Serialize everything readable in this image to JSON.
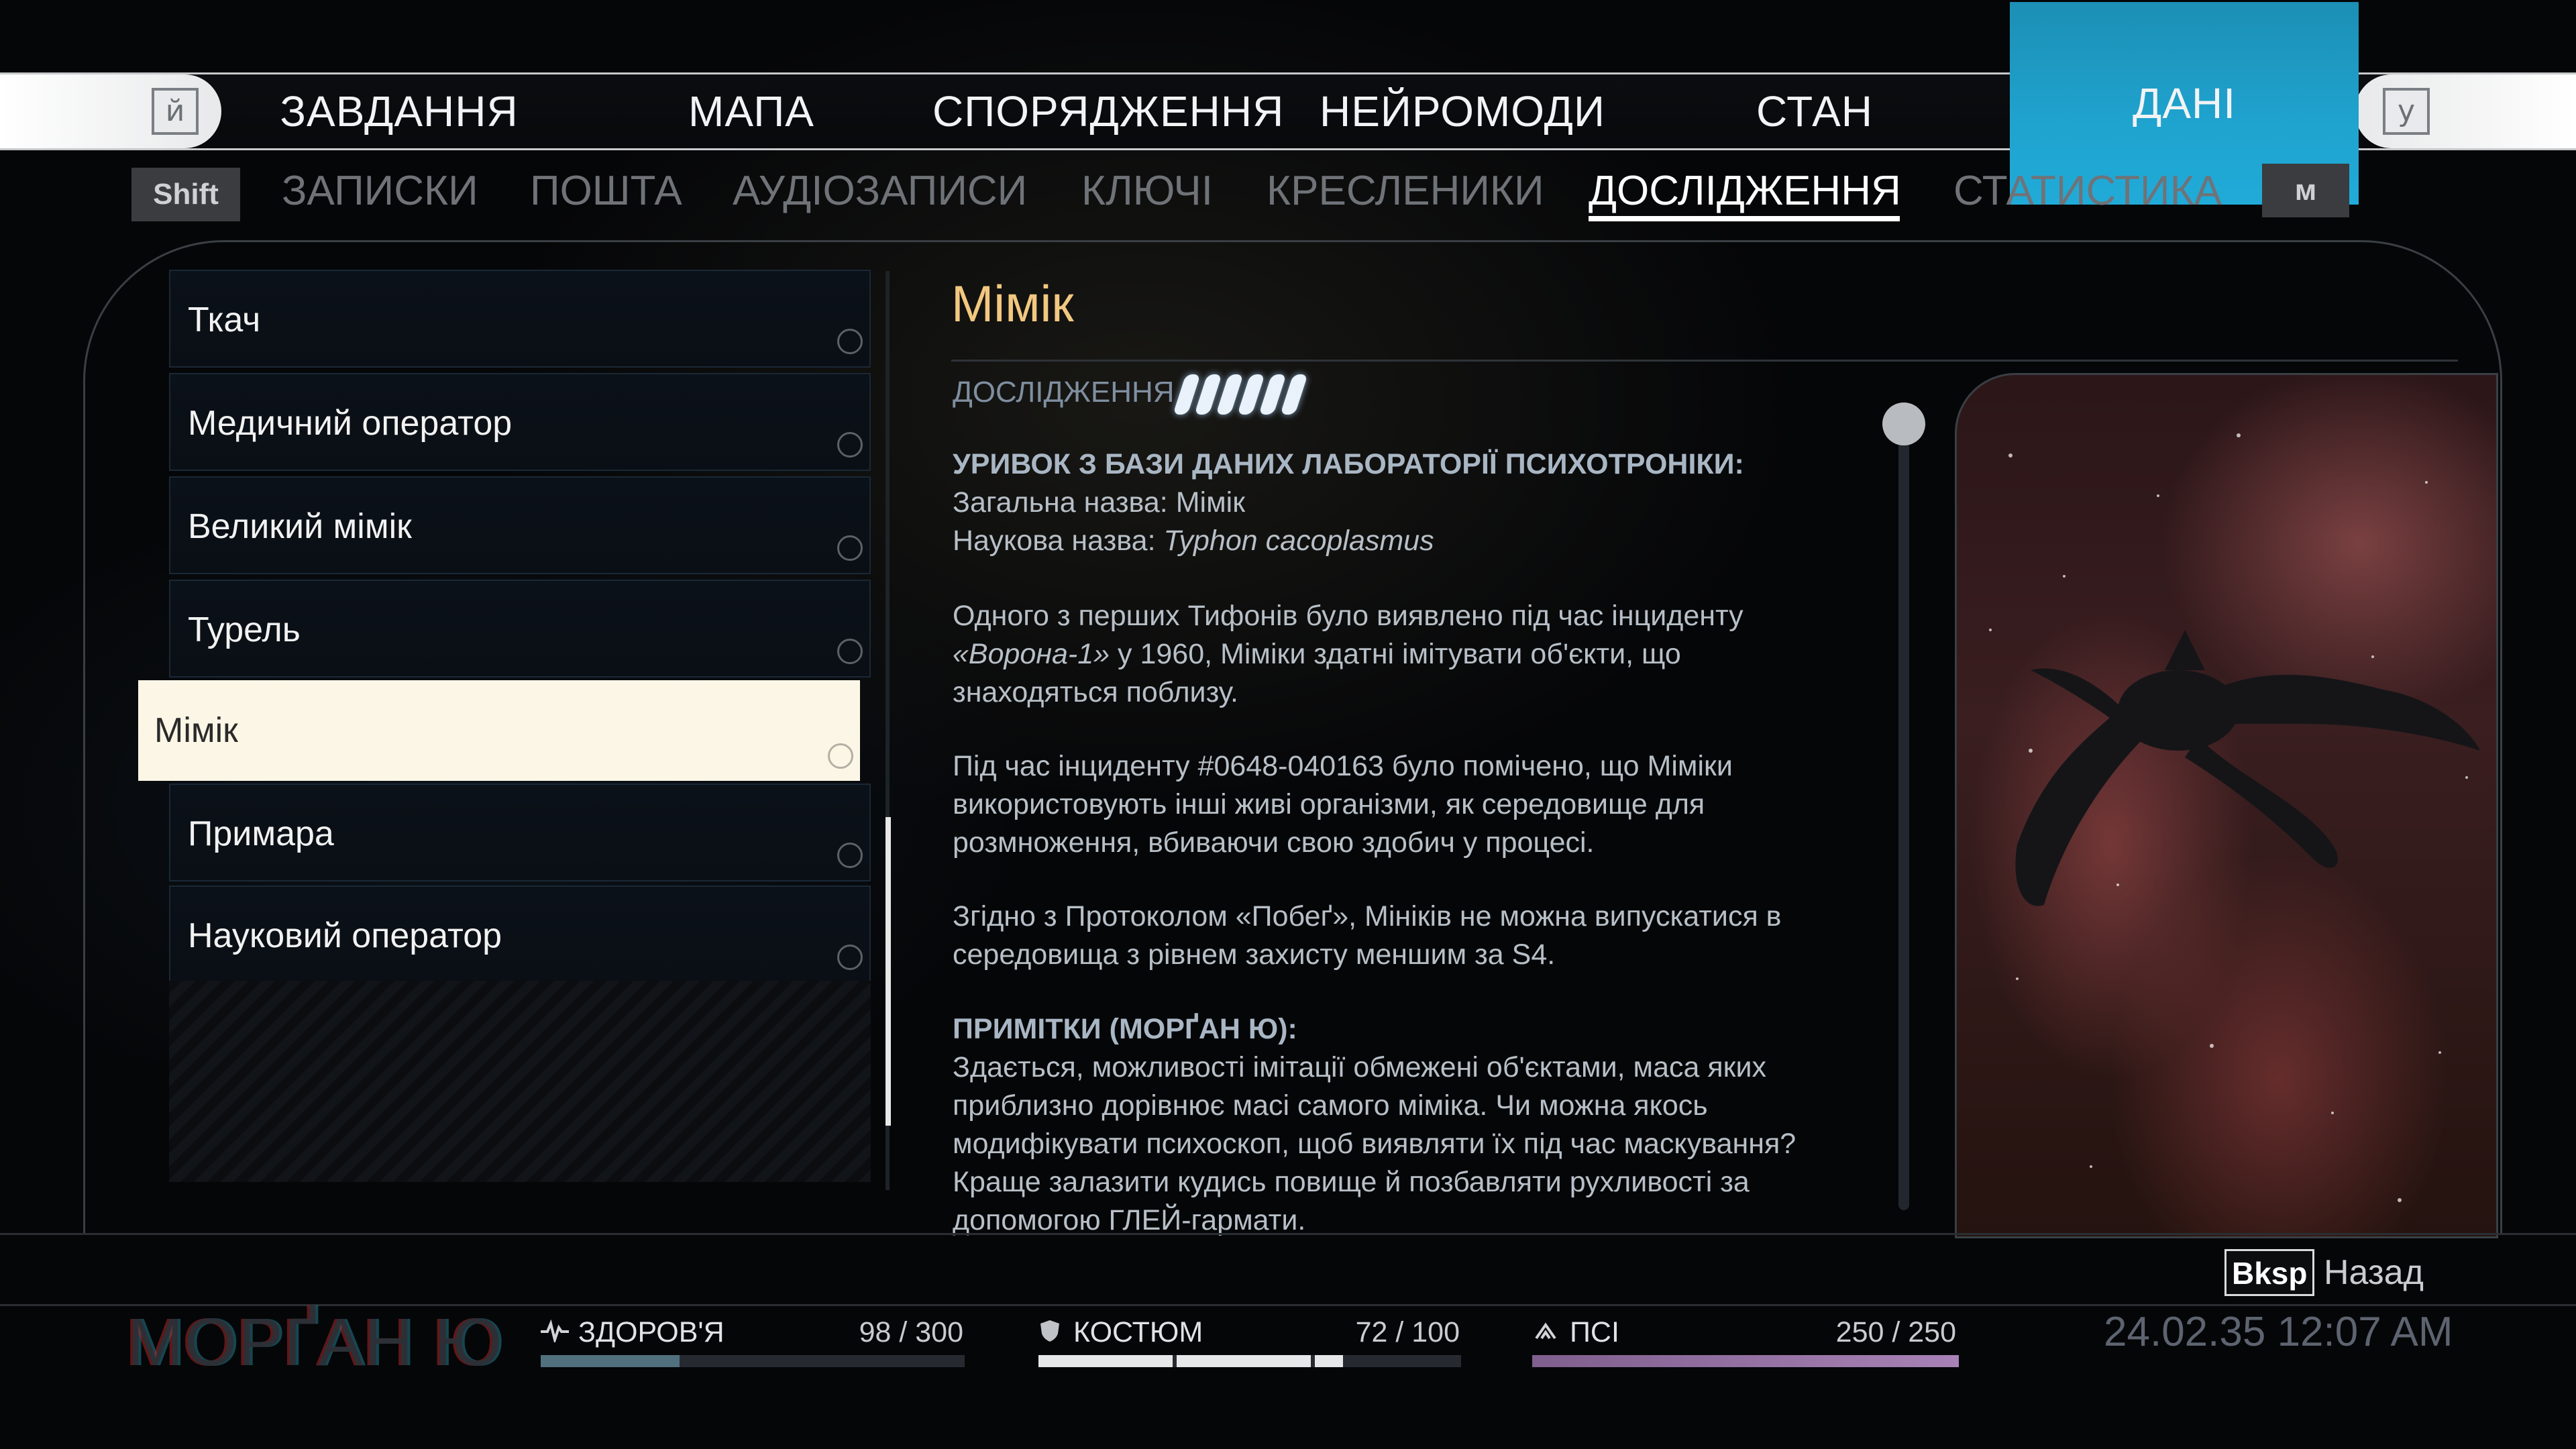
{
  "nav": {
    "key_left": "й",
    "key_right": "у",
    "tabs": [
      {
        "label": "ЗАВДАННЯ"
      },
      {
        "label": "МАПА"
      },
      {
        "label": "СПОРЯДЖЕННЯ"
      },
      {
        "label": "НЕЙРОМОДИ"
      },
      {
        "label": "СТАН"
      },
      {
        "label": "ДАНІ"
      }
    ],
    "active_tab": "ДАНІ",
    "accent_color": "#1fa3cf"
  },
  "subnav": {
    "key_left": "Shift",
    "key_right": "м",
    "tabs": [
      {
        "label": "ЗАПИСКИ"
      },
      {
        "label": "ПОШТА"
      },
      {
        "label": "АУДІОЗАПИСИ"
      },
      {
        "label": "КЛЮЧІ"
      },
      {
        "label": "КРЕСЛЕНИКИ"
      },
      {
        "label": "ДОСЛІДЖЕННЯ"
      },
      {
        "label": "СТАТИСТИКА"
      }
    ],
    "active_tab": "ДОСЛІДЖЕННЯ"
  },
  "list": {
    "items": [
      {
        "label": "Ткач"
      },
      {
        "label": "Медичний оператор"
      },
      {
        "label": "Великий мімік"
      },
      {
        "label": "Турель"
      },
      {
        "label": "Мімік"
      },
      {
        "label": "Примара"
      },
      {
        "label": "Науковий оператор"
      }
    ],
    "selected": "Мімік"
  },
  "detail": {
    "title": "Мімік",
    "research_label": "ДОСЛІДЖЕННЯ",
    "research_level": 6,
    "excerpt_heading": "УРИВОК З БАЗИ ДАНИХ ЛАБОРАТОРІЇ ПСИХОТРОНІКИ:",
    "common_name": "Загальна назва: Мімік",
    "scientific_prefix": "Наукова назва: ",
    "scientific_name": "Typhon cacoplasmus",
    "p1_line1": "Одного з перших Тифонів було виявлено під час інциденту",
    "p1_italic": "«Ворона-1»",
    "p1_line2_rest": " у 1960, Міміки здатні імітувати об'єкти, що",
    "p1_line3": "знаходяться поблизу.",
    "p2_line1": "Під час інциденту #0648-040163 було помічено, що Міміки",
    "p2_line2": "використовують інші живі організми, як середовище для",
    "p2_line3": "розмноження, вбиваючи свою здобич у процесі.",
    "p3_line1": "Згідно з Протоколом «Побеґ», Мініків не можна випускатися в",
    "p3_line2": "середовища з рівнем захисту меншим за S4.",
    "notes_heading": "ПРИМІТКИ (МОРҐАН Ю):",
    "n_line1": "Здається, можливості імітації обмежені об'єктами, маса яких",
    "n_line2": "приблизно дорівнює масі самого міміка. Чи можна якось",
    "n_line3": "модифікувати психоскоп, щоб виявляти їх під час маскування?",
    "n_line4": "Краще залазити кудись повище й позбавляти рухливості за",
    "n_line5": "допомогою ГЛЕЙ-гармати."
  },
  "footer": {
    "back_key": "Bksp",
    "back_label": "Назад",
    "player_name": "МОРҐАН Ю",
    "health": {
      "label": "ЗДОРОВ'Я",
      "value": "98 / 300",
      "fraction": 0.327,
      "icon": "heartbeat-icon"
    },
    "suit": {
      "label": "КОСТЮМ",
      "value": "72 / 100",
      "fraction": 0.72,
      "icon": "shield-icon"
    },
    "psi": {
      "label": "ПСІ",
      "value": "250 / 250",
      "fraction": 1.0,
      "icon": "psi-icon"
    },
    "datetime": "24.02.35 12:07 AM"
  }
}
